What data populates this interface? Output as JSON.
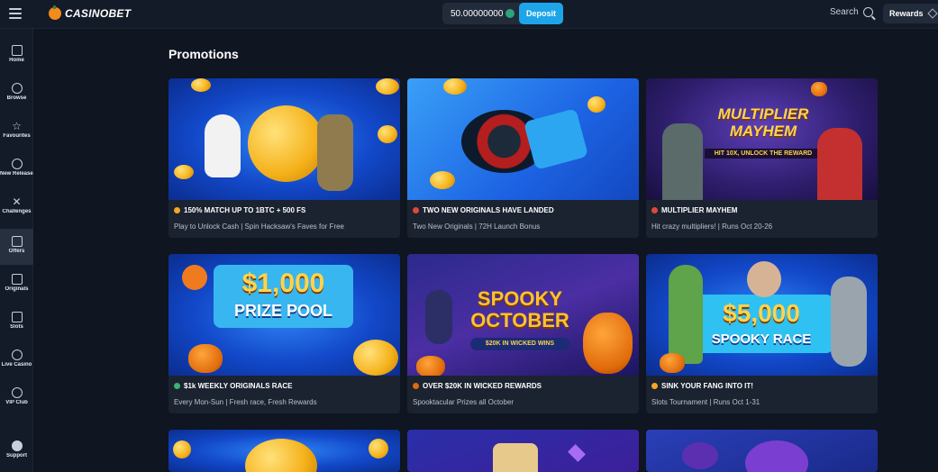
{
  "header": {
    "brand": "CASINOBET",
    "balance": "50.00000000",
    "deposit_label": "Deposit",
    "search_label": "Search",
    "rewards_label": "Rewards"
  },
  "sidebar": {
    "items": [
      {
        "label": "Home",
        "icon": "home-icon"
      },
      {
        "label": "Browse",
        "icon": "compass-icon"
      },
      {
        "label": "Favourites",
        "icon": "star-icon"
      },
      {
        "label": "New Releases",
        "icon": "new-releases-icon"
      },
      {
        "label": "Challenges",
        "icon": "swords-icon"
      },
      {
        "label": "Offers",
        "icon": "gift-icon",
        "active": true
      },
      {
        "label": "Originals",
        "icon": "originals-icon"
      },
      {
        "label": "Slots",
        "icon": "slots-icon"
      },
      {
        "label": "Live Casino",
        "icon": "live-casino-icon"
      },
      {
        "label": "VIP Club",
        "icon": "vip-icon"
      },
      {
        "label": "Support",
        "icon": "help-icon"
      }
    ]
  },
  "page": {
    "title": "Promotions"
  },
  "promotions": [
    {
      "title": "150% MATCH UP TO 1BTC + 500 FS",
      "subtitle": "Play to Unlock Cash | Spin Hacksaw's Faves for Free",
      "banner_text": "",
      "accent": "#f5a623"
    },
    {
      "title": "TWO NEW ORIGINALS HAVE LANDED",
      "subtitle": "Two New Originals | 72H Launch Bonus",
      "banner_text": "",
      "accent": "#e0473c"
    },
    {
      "title": "MULTIPLIER MAYHEM",
      "subtitle": "Hit crazy multipliers! | Runs Oct 20-26",
      "banner_text": "MULTIPLIER MAYHEM",
      "banner_sub": "HIT 10X, UNLOCK THE REWARD",
      "accent": "#e0473c"
    },
    {
      "title": "$1k WEEKLY ORIGINALS RACE",
      "subtitle": "Every Mon-Sun | Fresh race, Fresh Rewards",
      "banner_text": "$1,000",
      "banner_sub": "PRIZE POOL",
      "accent": "#3cb371"
    },
    {
      "title": "OVER $20K IN WICKED REWARDS",
      "subtitle": "Spooktacular Prizes all October",
      "banner_text": "SPOOKY OCTOBER",
      "banner_sub": "$20K IN WICKED WINS",
      "accent": "#e06a0a"
    },
    {
      "title": "SINK YOUR FANG INTO IT!",
      "subtitle": "Slots Tournament | Runs Oct 1-31",
      "banner_text": "$5,000",
      "banner_sub": "SPOOKY RACE",
      "accent": "#f5a623"
    }
  ]
}
